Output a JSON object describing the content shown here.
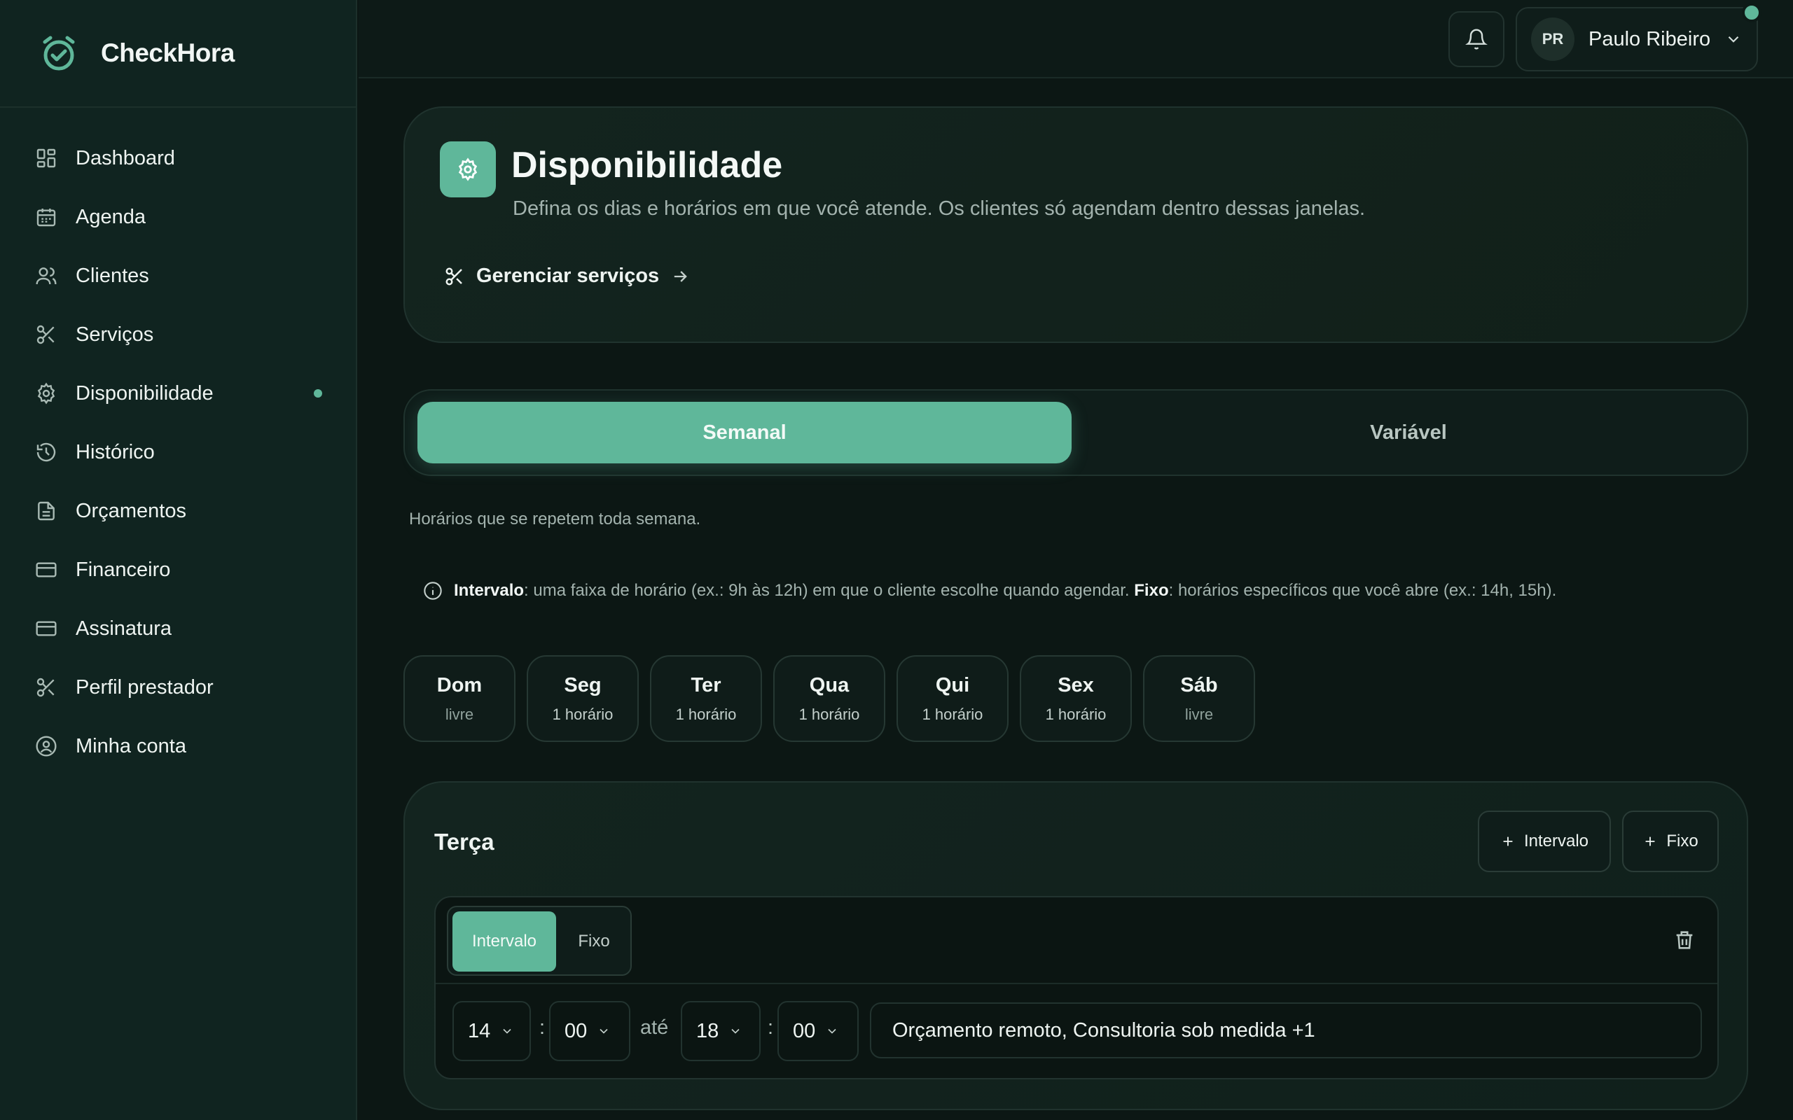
{
  "brand": {
    "name": "CheckHora"
  },
  "sidebar": {
    "items": [
      {
        "label": "Dashboard",
        "icon": "dashboard-icon"
      },
      {
        "label": "Agenda",
        "icon": "calendar-icon"
      },
      {
        "label": "Clientes",
        "icon": "users-icon"
      },
      {
        "label": "Serviços",
        "icon": "scissors-icon"
      },
      {
        "label": "Disponibilidade",
        "icon": "gear-icon",
        "active": true
      },
      {
        "label": "Histórico",
        "icon": "history-icon"
      },
      {
        "label": "Orçamentos",
        "icon": "document-icon"
      },
      {
        "label": "Financeiro",
        "icon": "credit-card-icon"
      },
      {
        "label": "Assinatura",
        "icon": "credit-card-icon"
      },
      {
        "label": "Perfil prestador",
        "icon": "scissors-icon"
      },
      {
        "label": "Minha conta",
        "icon": "user-circle-icon"
      }
    ]
  },
  "topbar": {
    "user": {
      "initials": "PR",
      "name": "Paulo Ribeiro"
    }
  },
  "header": {
    "title": "Disponibilidade",
    "subtitle": "Defina os dias e horários em que você atende. Os clientes só agendam dentro dessas janelas.",
    "manage_link": "Gerenciar serviços"
  },
  "tabs": {
    "weekly": "Semanal",
    "variable": "Variável"
  },
  "hint": "Horários que se repetem toda semana.",
  "info": {
    "interval_term": "Intervalo",
    "interval_text": ": uma faixa de horário (ex.: 9h às 12h) em que o cliente escolhe quando agendar. ",
    "fixed_term": "Fixo",
    "fixed_text": ": horários específicos que você abre (ex.: 14h, 15h)."
  },
  "days": [
    {
      "name": "Dom",
      "status": "livre"
    },
    {
      "name": "Seg",
      "status": "1 horário"
    },
    {
      "name": "Ter",
      "status": "1 horário"
    },
    {
      "name": "Qua",
      "status": "1 horário"
    },
    {
      "name": "Qui",
      "status": "1 horário"
    },
    {
      "name": "Sex",
      "status": "1 horário"
    },
    {
      "name": "Sáb",
      "status": "livre"
    }
  ],
  "day_card": {
    "title": "Terça",
    "add_interval": "Intervalo",
    "add_fixed": "Fixo",
    "slot": {
      "mode_interval": "Intervalo",
      "mode_fixed": "Fixo",
      "start_hour": "14",
      "start_minute": "00",
      "until": "até",
      "end_hour": "18",
      "end_minute": "00",
      "services": "Orçamento remoto, Consultoria sob medida +1"
    }
  },
  "colors": {
    "accent": "#5fb79a",
    "background": "#0c1714",
    "sidebar": "#102420"
  }
}
